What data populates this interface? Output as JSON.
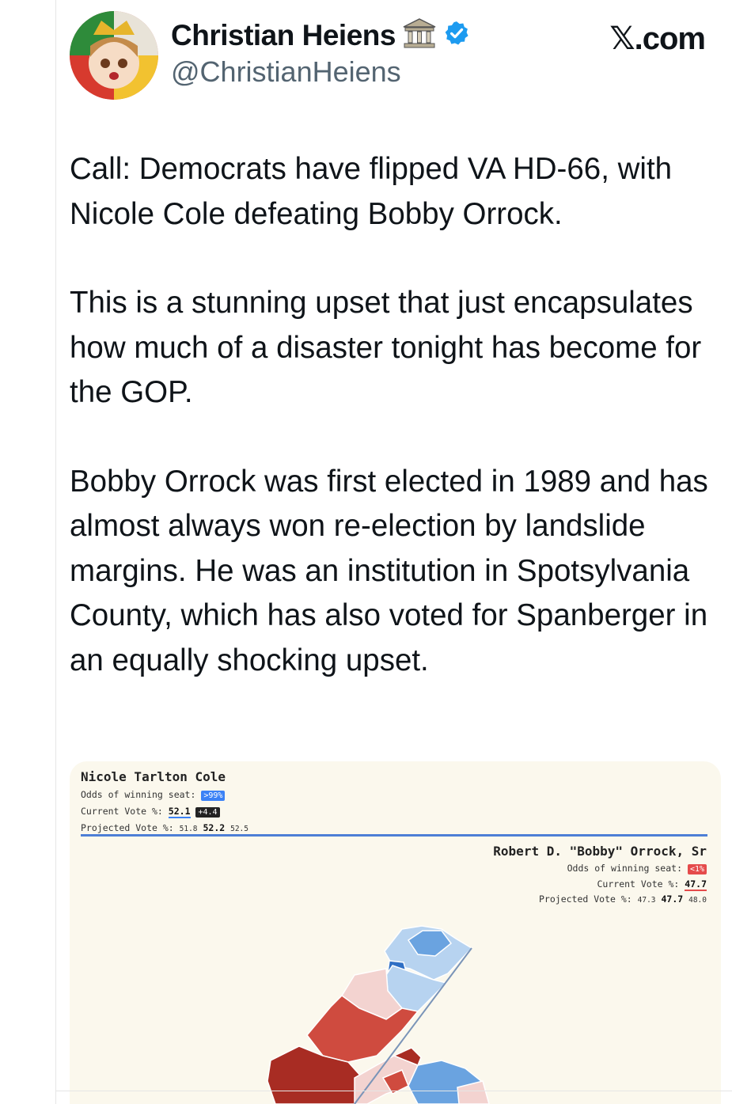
{
  "tweet": {
    "display_name": "Christian Heiens",
    "handle": "@ChristianHeiens",
    "brand": "𝕏.com",
    "paragraphs": [
      "Call: Democrats have flipped VA HD-66, with Nicole Cole defeating Bobby Orrock.",
      "This is a stunning upset that just encapsulates how much of a disaster tonight has become for the GOP.",
      "Bobby Orrock was first elected in 1989 and has almost always won re-election by landslide margins. He was an institution in Spotsylvania County, which has also voted for Spanberger in an equally shocking upset."
    ]
  },
  "embed": {
    "left_candidate": {
      "name": "Nicole Tarlton Cole",
      "odds_label": "Odds of winning seat:",
      "odds_value": ">99%",
      "current_label": "Current Vote %:",
      "current_value": "52.1",
      "current_delta": "+4.4",
      "projected_label": "Projected Vote %:",
      "projected_low": "51.8",
      "projected_mid": "52.2",
      "projected_high": "52.5"
    },
    "right_candidate": {
      "name": "Robert D. \"Bobby\" Orrock, Sr",
      "odds_label": "Odds of winning seat:",
      "odds_value": "<1%",
      "current_label": "Current Vote %:",
      "current_value": "47.7",
      "projected_label": "Projected Vote %:",
      "projected_low": "47.3",
      "projected_mid": "47.7",
      "projected_high": "48.0"
    }
  },
  "colors": {
    "dem_dark": "#2f6fc4",
    "dem_mid": "#6aa3e0",
    "dem_light": "#b7d3f0",
    "gop_dark": "#a82c23",
    "gop_mid": "#cf4b3f",
    "gop_light": "#f3d3d0",
    "verified": "#1d9bf0"
  }
}
